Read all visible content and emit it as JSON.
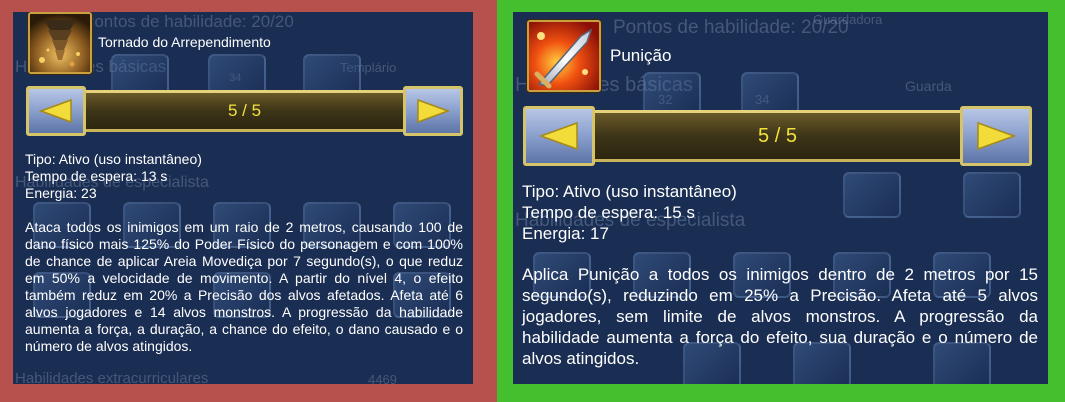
{
  "colors": {
    "left_frame": "#b7514d",
    "right_frame": "#44bf2e",
    "tooltip_bg": "#1a2d52",
    "level_text": "#f4e23a",
    "bar_border": "#e6d27a"
  },
  "background_ghost": {
    "left": {
      "header": "Pontos de habilidade: 20/20",
      "section_basic": "Habilidades básicas",
      "tab": "Templário",
      "section_specialist": "Habilidades de especialista",
      "section_extra": "Habilidades extracurriculares",
      "number": "4469",
      "slot_number": "34"
    },
    "right": {
      "header": "Pontos de habilidade: 20/20",
      "header_right": "Guardadora",
      "section_basic": "Habilidades básicas",
      "tab": "Guarda",
      "section_specialist": "Habilidades de especialista",
      "slot_number_a": "32",
      "slot_number_b": "34"
    }
  },
  "left_panel": {
    "skill_icon": "tornado-icon",
    "skill_name": "Tornado do Arrependimento",
    "level": "5 / 5",
    "type": "Tipo: Ativo (uso instantâneo)",
    "cooldown": "Tempo de espera: 13 s",
    "energy": "Energia: 23",
    "description": "Ataca todos os inimigos em um raio de 2 metros, causando 100 de dano físico mais 125% do Poder Físico do personagem e com 100% de chance de aplicar Areia Movediça por 7 segundo(s), o que reduz em 50% a velocidade de movimento. A partir do nível 4, o efeito também reduz em 20% a Precisão dos alvos afetados. Afeta até 6 alvos jogadores e 14 alvos monstros. A progressão da habilidade aumenta a força, a duração, a chance do efeito, o dano causado e o número de alvos atingidos."
  },
  "right_panel": {
    "skill_icon": "blade-strike-icon",
    "skill_name": "Punição",
    "level": "5 / 5",
    "type": "Tipo: Ativo (uso instantâneo)",
    "cooldown": "Tempo de espera: 15 s",
    "energy": "Energia: 17",
    "description": "Aplica Punição a todos os inimigos dentro de 2 metros por 15 segundo(s), reduzindo em 25% a Precisão. Afeta até 5 alvos jogadores, sem limite de alvos monstros. A progressão da habilidade aumenta a força do efeito, sua duração e o número de alvos atingidos."
  }
}
